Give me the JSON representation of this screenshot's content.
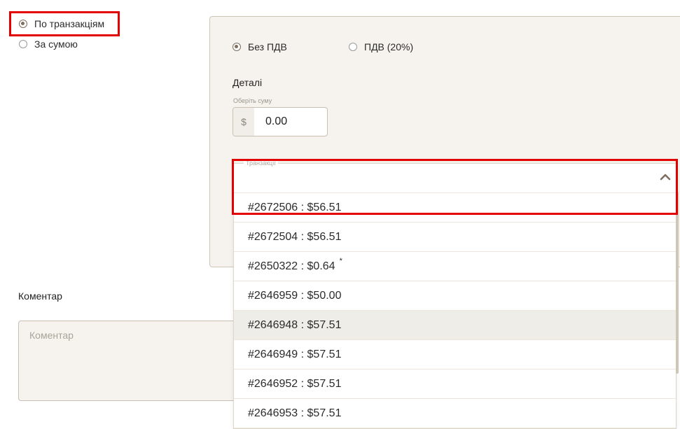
{
  "mode": {
    "by_transactions": "По транзакціям",
    "by_amount": "За сумою"
  },
  "vat": {
    "no_vat": "Без ПДВ",
    "vat_20": "ПДВ (20%)"
  },
  "details": {
    "title": "Деталі",
    "amount_label": "Оберіть суму",
    "currency": "$",
    "amount_value": "0.00"
  },
  "transactions": {
    "legend": "Транзакції",
    "items": [
      {
        "label": "#2672506 : $56.51",
        "mark": ""
      },
      {
        "label": "#2672504 : $56.51",
        "mark": ""
      },
      {
        "label": "#2650322 : $0.64",
        "mark": "*"
      },
      {
        "label": "#2646959 : $50.00",
        "mark": ""
      },
      {
        "label": "#2646948 : $57.51",
        "mark": ""
      },
      {
        "label": "#2646949 : $57.51",
        "mark": ""
      },
      {
        "label": "#2646952 : $57.51",
        "mark": ""
      },
      {
        "label": "#2646953 : $57.51",
        "mark": ""
      }
    ]
  },
  "comment": {
    "title": "Коментар",
    "placeholder": "Коментар"
  },
  "colors": {
    "highlight": "#e30000",
    "panel_bg": "#f6f3ee",
    "radio_checked": "#7d6e5e"
  }
}
